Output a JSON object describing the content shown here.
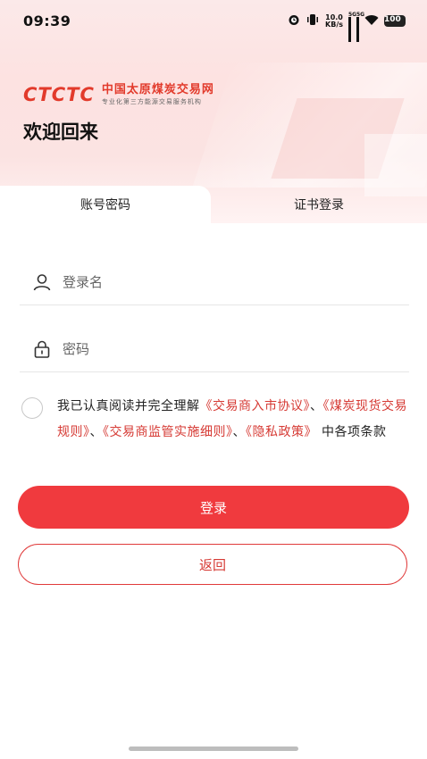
{
  "status_bar": {
    "time": "09:39",
    "net_speed_value": "10.0",
    "net_speed_unit": "KB/s",
    "signal1_label": "5G",
    "signal2_label": "5G",
    "battery": "100"
  },
  "header": {
    "logo_mark": "CTCTC",
    "logo_title": "中国太原煤炭交易网",
    "logo_subtitle": "专业化第三方能源交易服务机构",
    "welcome": "欢迎回来"
  },
  "tabs": [
    {
      "label": "账号密码",
      "active": true
    },
    {
      "label": "证书登录",
      "active": false
    }
  ],
  "form": {
    "username_placeholder": "登录名",
    "password_placeholder": "密码"
  },
  "agreement": {
    "prefix": "我已认真阅读并完全理解",
    "link1": "《交易商入市协议》",
    "sep1": "、",
    "link2": "《煤炭现货交易规则》",
    "sep2": "、",
    "link3": "《交易商监管实施细则》",
    "sep3": "、",
    "link4": "《隐私政策》",
    "suffix": "中各项条款"
  },
  "buttons": {
    "login": "登录",
    "back": "返回"
  },
  "colors": {
    "accent": "#f03a3e",
    "link": "#d63a34"
  }
}
